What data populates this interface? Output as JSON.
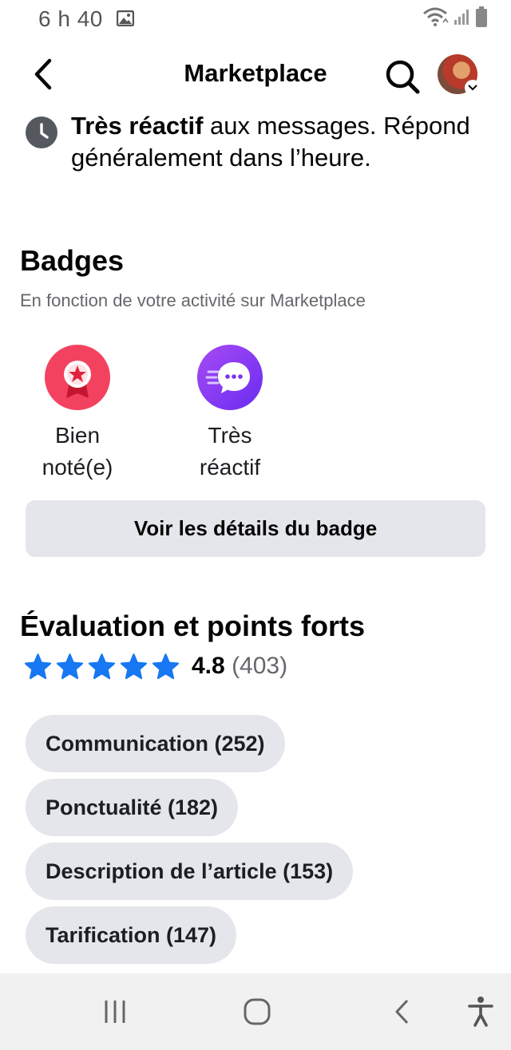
{
  "status_bar": {
    "time": "6 h 40",
    "icons": [
      "gallery-icon",
      "wifi-icon",
      "signal-icon",
      "battery-icon"
    ]
  },
  "header": {
    "title": "Marketplace",
    "back_icon": "chevron-left-icon",
    "search_icon": "search-icon",
    "avatar_icon": "avatar"
  },
  "response_info": {
    "strong": "Très réactif",
    "rest": " aux messages. Répond généralement dans l’heure."
  },
  "badges": {
    "title": "Badges",
    "subtitle": "En fonction de votre activité sur Marketplace",
    "items": [
      {
        "line1": "Bien",
        "line2": "noté(e)",
        "icon": "rated-medal-icon",
        "color": "#f3425f"
      },
      {
        "line1": "Très",
        "line2": "réactif",
        "icon": "chat-bubble-icon",
        "color": "#8a3ffc"
      }
    ],
    "details_button": "Voir les détails du badge"
  },
  "rating": {
    "title": "Évaluation et points forts",
    "stars": 5,
    "score": "4.8",
    "count": "(403)",
    "star_color": "#1877f2",
    "highlights": [
      "Communication (252)",
      "Ponctualité (182)",
      "Description de l’article (153)",
      "Tarification (147)"
    ]
  },
  "nav_bar": {
    "buttons": [
      "recent-apps-icon",
      "home-icon",
      "back-icon",
      "accessibility-icon"
    ]
  }
}
